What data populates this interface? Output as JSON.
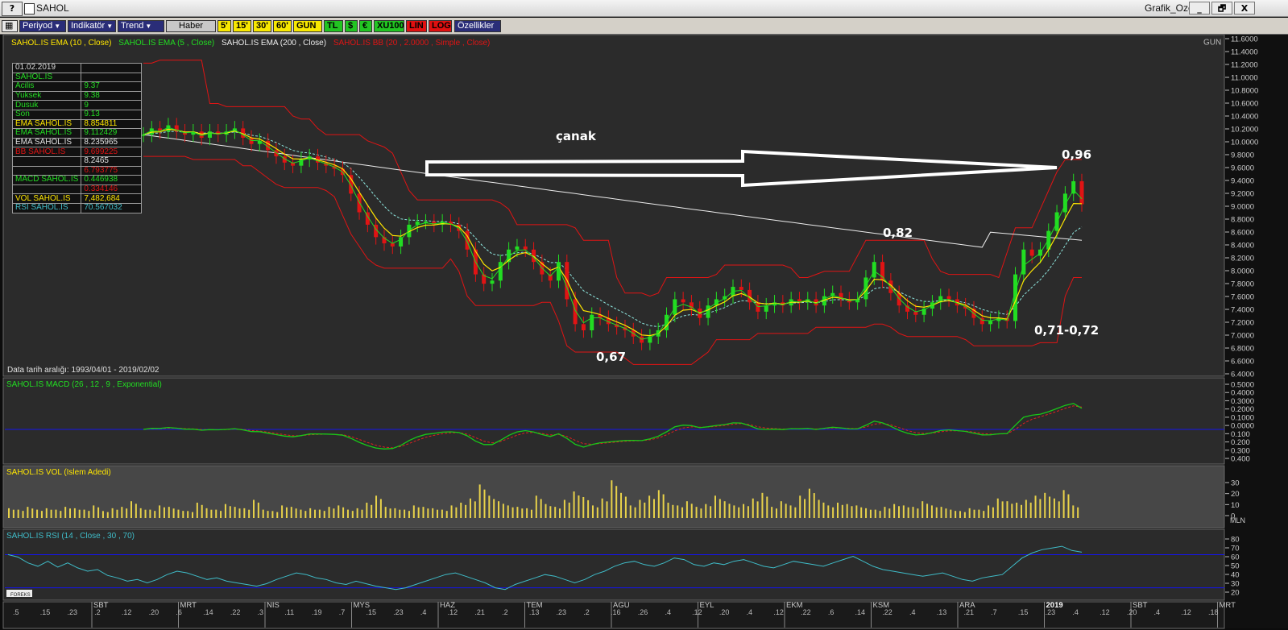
{
  "window": {
    "title": "SAHOL",
    "help_label": "?",
    "right_title": "Grafik_Ozel",
    "minimize": "_",
    "restore": "🗗",
    "close": "X"
  },
  "toolbar": {
    "periyod": "Periyod",
    "indikator": "Indikatör",
    "trend": "Trend",
    "haber": "Haber",
    "p5": "5'",
    "p15": "15'",
    "p30": "30'",
    "p60": "60'",
    "gun": "GUN",
    "tl": "TL",
    "usd": "$",
    "eur": "€",
    "xu100": "XU100",
    "lin": "LIN",
    "log": "LOG",
    "ozellikler": "Özellikler"
  },
  "colors": {
    "price_bg": "#2b2b2b",
    "vol_bg": "#474747",
    "ema10": "#ffe600",
    "ema5": "#22dd22",
    "ema200": "#ececec",
    "bb": "#e01414",
    "macd": "#18c818",
    "signal": "#e02020",
    "rsi": "#3fbcc8",
    "up_candle": "#22dd22",
    "down_candle": "#e01414",
    "vol_bar": "#e8d24a",
    "ref_line": "#1414ee"
  },
  "legend": {
    "ema10": "SAHOL.IS EMA (10 , Close)",
    "ema5": "SAHOL.IS EMA (5 , Close)",
    "ema200": "SAHOL.IS EMA (200 , Close)",
    "bb": "SAHOL.IS BB (20 , 2.0000 , Simple , Close)",
    "period": "GUN"
  },
  "data_table": [
    {
      "label": "01.02.2019",
      "value": "",
      "color": "#d8d8d8"
    },
    {
      "label": "SAHOL.IS",
      "value": "",
      "color": "#22dd22"
    },
    {
      "label": " Acilis",
      "value": "9.37",
      "color": "#22dd22"
    },
    {
      "label": " Yuksek",
      "value": "9.38",
      "color": "#22dd22"
    },
    {
      "label": " Dusuk",
      "value": "9",
      "color": "#22dd22"
    },
    {
      "label": " Son",
      "value": "9.13",
      "color": "#22dd22"
    },
    {
      "label": "EMA SAHOL.IS",
      "value": "8.854811",
      "color": "#ffe600"
    },
    {
      "label": "EMA SAHOL.IS",
      "value": "9.112429",
      "color": "#22dd22"
    },
    {
      "label": "EMA SAHOL.IS",
      "value": "8.235965",
      "color": "#e0e0e0"
    },
    {
      "label": "BB SAHOL.IS",
      "value": "9.699225",
      "color": "#e01414"
    },
    {
      "label": "",
      "value": "8.2465",
      "color": "#e0e0e0"
    },
    {
      "label": "",
      "value": "6.793775",
      "color": "#e01414"
    },
    {
      "label": "MACD SAHOL.IS",
      "value": "0.446938",
      "color": "#22dd22"
    },
    {
      "label": "",
      "value": "0.334146",
      "color": "#e01414"
    },
    {
      "label": "VOL SAHOL.IS",
      "value": "7,482,684",
      "color": "#ffe600"
    },
    {
      "label": "RSI SAHOL.IS",
      "value": "70.567032",
      "color": "#3fbcc8"
    }
  ],
  "date_range": "Data tarih aralığı: 1993/04/01 - 2019/02/02",
  "annotations": {
    "canak": "çanak",
    "p096": "0,96",
    "p082": "0,82",
    "p067": "0,67",
    "p0712": "0,71-0,72"
  },
  "price_axis": {
    "min": 6.4,
    "max": 11.6,
    "ticks": [
      "11.6000",
      "11.4000",
      "11.2000",
      "11.0000",
      "10.8000",
      "10.6000",
      "10.4000",
      "10.2000",
      "10.0000",
      "9.8000",
      "9.6000",
      "9.4000",
      "9.2000",
      "9.0000",
      "8.8000",
      "8.6000",
      "8.4000",
      "8.2000",
      "8.0000",
      "7.8000",
      "7.6000",
      "7.4000",
      "7.2000",
      "7.0000",
      "6.8000",
      "6.6000",
      "6.4000"
    ]
  },
  "macd_panel": {
    "title": "SAHOL.IS MACD (26 , 12 , 9 , Exponential)",
    "ticks": [
      "0.5000",
      "0.4000",
      "0.3000",
      "0.2000",
      "0.1000",
      "0.0000",
      "0.100",
      "0.200",
      "0.300",
      "0.400"
    ]
  },
  "vol_panel": {
    "title": "SAHOL.IS VOL (Islem Adedi)",
    "ticks": [
      "30",
      "20",
      "10",
      "0"
    ],
    "unit": "MLN"
  },
  "rsi_panel": {
    "title": "SAHOL.IS RSI (14 , Close , 30 , 70)",
    "ticks": [
      "80",
      "70",
      "60",
      "50",
      "40",
      "30",
      "20"
    ],
    "overbought": 70,
    "oversold": 30
  },
  "time_axis": {
    "months": [
      "SBT",
      "MRT",
      "NIS",
      "MYS",
      "HAZ",
      "TEM",
      "AGU",
      "EYL",
      "EKM",
      "KSM",
      "ARA",
      "2019",
      "SBT",
      "MRT"
    ],
    "days": [
      ".5",
      ".15",
      ".23",
      ".2",
      ".12",
      ".20",
      ".6",
      ".14",
      ".22",
      ".3",
      ".11",
      ".19",
      ".7",
      ".15",
      ".23",
      ".4",
      ".12",
      ".21",
      ".2",
      ".13",
      ".23",
      ".2",
      ".16",
      ".26",
      ".4",
      ".12",
      ".20",
      ".4",
      ".12",
      ".22",
      ".6",
      ".14",
      ".22",
      ".4",
      ".13",
      ".21",
      ".7",
      ".15",
      ".23",
      ".4",
      ".12",
      ".20",
      ".4",
      ".12",
      ".18"
    ]
  },
  "chart_data": {
    "type": "candlestick",
    "ylim": [
      6.4,
      11.6
    ],
    "close_path": [
      10.25,
      10.35,
      10.3,
      10.4,
      10.3,
      10.25,
      10.3,
      10.2,
      10.3,
      10.25,
      10.3,
      10.35,
      10.2,
      10.1,
      10.15,
      10.0,
      9.9,
      9.8,
      9.75,
      9.85,
      9.9,
      9.8,
      9.75,
      9.7,
      9.6,
      9.3,
      9.0,
      8.8,
      8.6,
      8.5,
      8.45,
      8.6,
      8.8,
      8.85,
      8.85,
      8.8,
      8.85,
      8.8,
      8.7,
      8.4,
      8.0,
      7.85,
      7.9,
      8.2,
      8.4,
      8.45,
      8.4,
      8.2,
      8.0,
      7.9,
      8.2,
      7.6,
      7.2,
      7.1,
      7.35,
      7.3,
      7.2,
      7.15,
      7.1,
      7.0,
      6.9,
      7.0,
      7.1,
      7.35,
      7.6,
      7.55,
      7.45,
      7.3,
      7.5,
      7.6,
      7.65,
      7.8,
      7.75,
      7.55,
      7.4,
      7.5,
      7.55,
      7.5,
      7.6,
      7.55,
      7.6,
      7.5,
      7.65,
      7.7,
      7.6,
      7.55,
      7.6,
      7.95,
      8.2,
      7.9,
      7.7,
      7.5,
      7.4,
      7.35,
      7.45,
      7.55,
      7.65,
      7.6,
      7.5,
      7.45,
      7.3,
      7.2,
      7.25,
      7.3,
      7.25,
      8.0,
      8.4,
      8.3,
      8.4,
      8.7,
      9.0,
      9.3,
      9.5,
      9.13
    ],
    "vol_path": [
      7,
      6,
      8,
      6,
      7,
      6,
      8,
      7,
      6,
      9,
      5,
      7,
      8,
      12,
      7,
      6,
      9,
      8,
      6,
      5,
      11,
      7,
      6,
      10,
      8,
      7,
      13,
      6,
      5,
      9,
      8,
      6,
      7,
      6,
      8,
      9,
      6,
      7,
      11,
      16,
      8,
      7,
      6,
      9,
      8,
      7,
      6,
      9,
      11,
      14,
      24,
      16,
      12,
      9,
      8,
      7,
      16,
      10,
      8,
      13,
      19,
      15,
      9,
      14,
      27,
      18,
      9,
      13,
      16,
      20,
      11,
      9,
      12,
      8,
      10,
      16,
      12,
      9,
      10,
      14,
      18,
      8,
      12,
      9,
      16,
      21,
      13,
      9,
      11,
      10,
      9,
      7,
      6,
      8,
      10,
      9,
      8,
      12,
      9,
      8,
      6,
      5,
      7,
      6,
      9,
      14,
      12,
      11,
      13,
      16,
      18,
      14,
      20,
      9
    ],
    "rsi_path": [
      70,
      67,
      60,
      56,
      62,
      55,
      60,
      54,
      50,
      52,
      45,
      42,
      38,
      40,
      36,
      40,
      46,
      50,
      48,
      44,
      40,
      42,
      38,
      36,
      34,
      32,
      35,
      40,
      44,
      48,
      46,
      42,
      40,
      36,
      34,
      38,
      35,
      32,
      30,
      28,
      30,
      34,
      38,
      42,
      46,
      48,
      44,
      40,
      36,
      30,
      28,
      34,
      38,
      42,
      46,
      44,
      40,
      36,
      40,
      46,
      50,
      56,
      60,
      62,
      58,
      56,
      60,
      66,
      64,
      58,
      56,
      60,
      58,
      62,
      64,
      60,
      56,
      54,
      58,
      62,
      60,
      58,
      56,
      60,
      64,
      68,
      62,
      56,
      52,
      50,
      48,
      46,
      44,
      46,
      48,
      44,
      40,
      38,
      42,
      44,
      46,
      56,
      66,
      72,
      76,
      78,
      80,
      75,
      73
    ]
  }
}
